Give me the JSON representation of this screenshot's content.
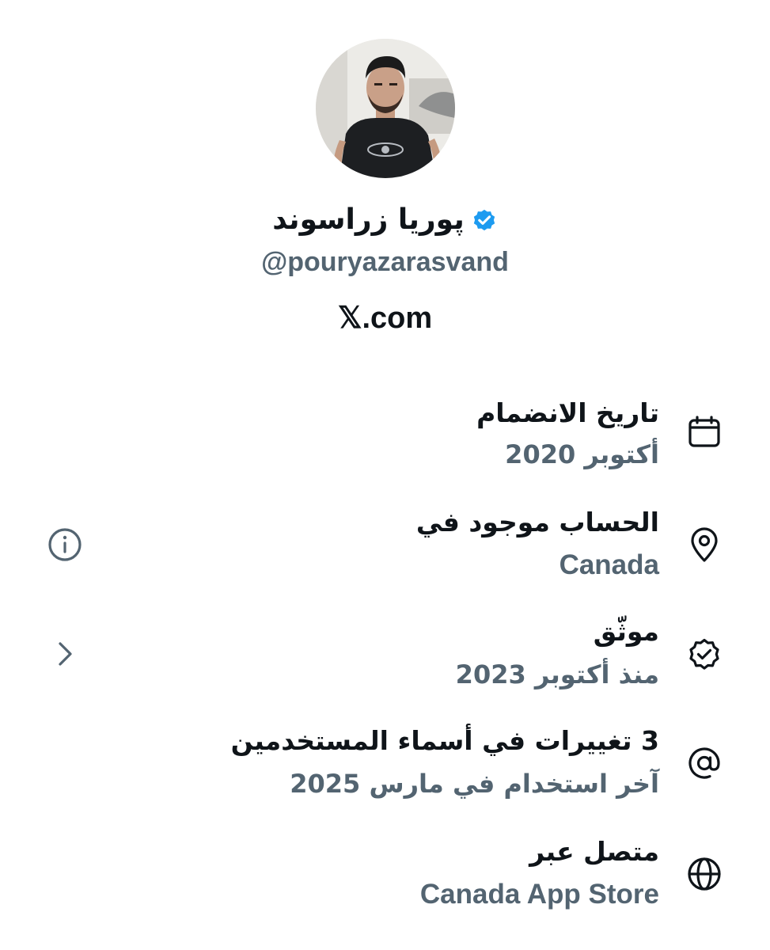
{
  "profile": {
    "display_name": "پوریا زراسوند",
    "handle": "@pouryazarasvand",
    "website": "𝕏.com",
    "verified_badge_color": "#1d9bf0"
  },
  "about_rows": [
    {
      "icon": "calendar-icon",
      "title": "تاريخ الانضمام",
      "subtitle": "أكتوبر 2020"
    },
    {
      "icon": "location-pin-icon",
      "title": "الحساب موجود في",
      "subtitle": "Canada",
      "side_icon": "info-icon"
    },
    {
      "icon": "verified-badge-icon",
      "title": "موثّق",
      "subtitle": "منذ أكتوبر 2023",
      "side_icon": "chevron-right-icon"
    },
    {
      "icon": "at-sign-icon",
      "title": "3 تغييرات في أسماء المستخدمين",
      "subtitle": "آخر استخدام في مارس 2025"
    },
    {
      "icon": "globe-icon",
      "title": "متصل عبر",
      "subtitle": "Canada App Store"
    }
  ],
  "colors": {
    "primary_text": "#0f1419",
    "secondary_text": "#536471",
    "background": "#ffffff"
  }
}
